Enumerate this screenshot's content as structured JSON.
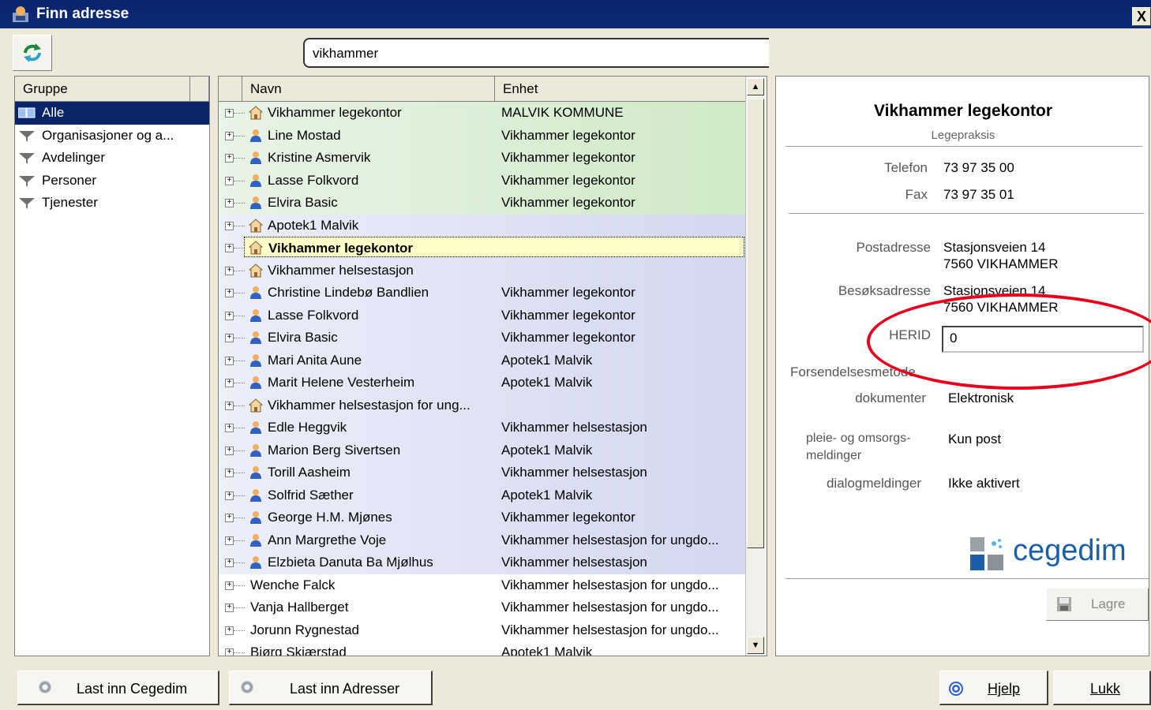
{
  "window": {
    "title": "Finn adresse",
    "close_label": "X"
  },
  "search": {
    "value": "vikhammer"
  },
  "group_panel": {
    "header": "Gruppe",
    "items": [
      {
        "label": "Alle",
        "selected": true,
        "icon": "book-icon"
      },
      {
        "label": "Organisasjoner og a...",
        "icon": "filter-icon"
      },
      {
        "label": "Avdelinger",
        "icon": "filter-icon"
      },
      {
        "label": "Personer",
        "icon": "filter-icon"
      },
      {
        "label": "Tjenester",
        "icon": "filter-icon"
      }
    ]
  },
  "list": {
    "columns": [
      "Navn",
      "Enhet"
    ],
    "rows": [
      {
        "name": "Vikhammer legekontor",
        "unit": "MALVIK KOMMUNE",
        "icon": "house",
        "bg": "green"
      },
      {
        "name": "Line Mostad",
        "unit": "Vikhammer legekontor",
        "icon": "person",
        "bg": "green"
      },
      {
        "name": "Kristine Asmervik",
        "unit": "Vikhammer legekontor",
        "icon": "person",
        "bg": "green"
      },
      {
        "name": "Lasse Folkvord",
        "unit": "Vikhammer legekontor",
        "icon": "person",
        "bg": "green"
      },
      {
        "name": "Elvira Basic",
        "unit": "Vikhammer legekontor",
        "icon": "person",
        "bg": "green"
      },
      {
        "name": "Apotek1 Malvik",
        "unit": "",
        "icon": "house",
        "bg": "blue"
      },
      {
        "name": "Vikhammer legekontor",
        "unit": "",
        "icon": "house",
        "bg": "blue",
        "selected": true
      },
      {
        "name": "Vikhammer helsestasjon",
        "unit": "",
        "icon": "house",
        "bg": "blue"
      },
      {
        "name": "Christine Lindebø Bandlien",
        "unit": "Vikhammer legekontor",
        "icon": "person",
        "bg": "blue"
      },
      {
        "name": "Lasse Folkvord",
        "unit": "Vikhammer legekontor",
        "icon": "person",
        "bg": "blue"
      },
      {
        "name": "Elvira Basic",
        "unit": "Vikhammer legekontor",
        "icon": "person",
        "bg": "blue"
      },
      {
        "name": "Mari Anita Aune",
        "unit": "Apotek1 Malvik",
        "icon": "person",
        "bg": "blue"
      },
      {
        "name": "Marit Helene Vesterheim",
        "unit": "Apotek1 Malvik",
        "icon": "person",
        "bg": "blue"
      },
      {
        "name": "Vikhammer helsestasjon for ung...",
        "unit": "",
        "icon": "house",
        "bg": "blue"
      },
      {
        "name": "Edle Heggvik",
        "unit": "Vikhammer helsestasjon",
        "icon": "person",
        "bg": "blue"
      },
      {
        "name": "Marion Berg Sivertsen",
        "unit": "Apotek1 Malvik",
        "icon": "person",
        "bg": "blue"
      },
      {
        "name": "Torill Aasheim",
        "unit": "Vikhammer helsestasjon",
        "icon": "person",
        "bg": "blue"
      },
      {
        "name": "Solfrid Sæther",
        "unit": "Apotek1 Malvik",
        "icon": "person",
        "bg": "blue"
      },
      {
        "name": "George H.M. Mjønes",
        "unit": "Vikhammer legekontor",
        "icon": "person",
        "bg": "blue"
      },
      {
        "name": "Ann Margrethe Voje",
        "unit": "Vikhammer helsestasjon for ungdo...",
        "icon": "person",
        "bg": "blue"
      },
      {
        "name": "Elzbieta Danuta Ba Mjølhus",
        "unit": "Vikhammer helsestasjon",
        "icon": "person",
        "bg": "blue"
      },
      {
        "name": "Wenche Falck",
        "unit": "Vikhammer helsestasjon for ungdo...",
        "icon": "",
        "bg": "white"
      },
      {
        "name": "Vanja Hallberget",
        "unit": "Vikhammer helsestasjon for ungdo...",
        "icon": "",
        "bg": "white"
      },
      {
        "name": "Jorunn Rygnestad",
        "unit": "Vikhammer helsestasjon for ungdo...",
        "icon": "",
        "bg": "white"
      },
      {
        "name": "Bjørg Skjærstad",
        "unit": "Apotek1 Malvik",
        "icon": "",
        "bg": "white"
      }
    ]
  },
  "detail": {
    "title": "Vikhammer legekontor",
    "subtitle": "Legepraksis",
    "telefon_label": "Telefon",
    "telefon": "73 97 35 00",
    "fax_label": "Fax",
    "fax": "73 97 35 01",
    "postadresse_label": "Postadresse",
    "postadresse_1": "Stasjonsveien 14",
    "postadresse_2": "7560 VIKHAMMER",
    "besoksadresse_label": "Besøksadresse",
    "besoksadresse_1": "Stasjonsveien 14",
    "besoksadresse_2": "7560 VIKHAMMER",
    "herid_label": "HERID",
    "herid_value": "0",
    "forsendelse_label": "Forsendelsesmetode",
    "dokumenter_label": "dokumenter",
    "dokumenter_value": "Elektronisk",
    "pleie_label_1": "pleie- og omsorgs-",
    "pleie_label_2": "meldinger",
    "pleie_value": "Kun post",
    "dialog_label": "dialogmeldinger",
    "dialog_value": "Ikke aktivert",
    "logo_text": "cegedim",
    "save_label": "Lagre"
  },
  "bottom": {
    "load_cegedim": "Last inn Cegedim",
    "load_addresses": "Last inn Adresser",
    "help": "Hjelp",
    "close": "Lukk"
  },
  "colors": {
    "titlebar": "#0a246a",
    "highlight": "#e8001c",
    "logo_blue": "#1a5fa8"
  }
}
